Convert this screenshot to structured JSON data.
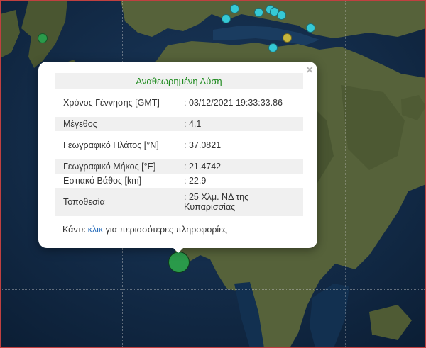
{
  "popup": {
    "title": "Αναθεωρημένη Λύση",
    "close_icon": "×",
    "rows": [
      {
        "label": "Χρόνος Γέννησης [GMT]",
        "value": ": 03/12/2021 19:33:33.86"
      },
      {
        "label": "Μέγεθος",
        "value": ": 4.1"
      },
      {
        "label": "Γεωγραφικό Πλάτος [°N]",
        "value": ": 37.0821"
      },
      {
        "label": "Γεωγραφικό Μήκος [°E]",
        "value": ": 21.4742"
      },
      {
        "label": "Εστιακό Βάθος [km]",
        "value": ": 22.9"
      },
      {
        "label": "Τοποθεσία",
        "value": ": 25 Χλμ. ΝΔ της Κυπαρισσίας"
      }
    ],
    "footer_before": "Κάντε ",
    "footer_link": "κλικ",
    "footer_after": " για περισσότερες πληροφορίες"
  },
  "colors": {
    "sea": "#0f2742",
    "land": "#4e5a34",
    "quake_cyan": "#35c9d6",
    "quake_green": "#2a9a4a",
    "quake_yellow": "#c6b63c",
    "title_green": "#1e8a1e",
    "link_blue": "#2a6ebb"
  }
}
